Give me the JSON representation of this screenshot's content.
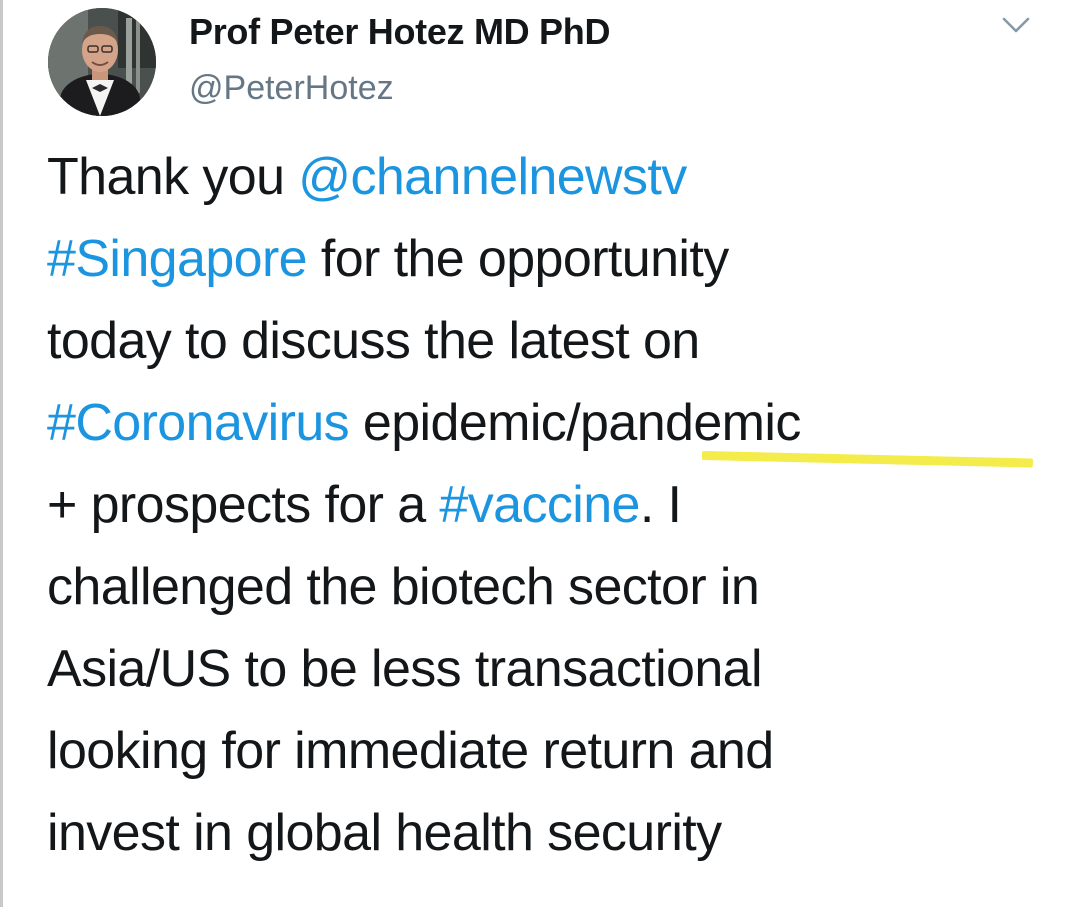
{
  "tweet": {
    "author": {
      "display_name": "Prof Peter Hotez MD PhD",
      "handle": "@PeterHotez",
      "avatar_icon": "profile-photo"
    },
    "menu_icon": "chevron-down-icon",
    "body_lines": [
      [
        {
          "text": "Thank you "
        },
        {
          "text": "@channelnewstv",
          "link": true
        }
      ],
      [
        {
          "text": "#Singapore",
          "link": true
        },
        {
          "text": " for the opportunity"
        }
      ],
      [
        {
          "text": "today to discuss the latest on"
        }
      ],
      [
        {
          "text": "#Coronavirus",
          "link": true
        },
        {
          "text": " epidemic/pandemic"
        }
      ],
      [
        {
          "text": "+ prospects for a "
        },
        {
          "text": "#vaccine",
          "link": true
        },
        {
          "text": ". I"
        }
      ],
      [
        {
          "text": "challenged the biotech sector in"
        }
      ],
      [
        {
          "text": "Asia/US to be less transactional"
        }
      ],
      [
        {
          "text": "looking for immediate return and"
        }
      ],
      [
        {
          "text": "invest in global health security"
        }
      ]
    ],
    "highlight_color": "#f3ec4a",
    "link_color": "#1b95e0"
  }
}
